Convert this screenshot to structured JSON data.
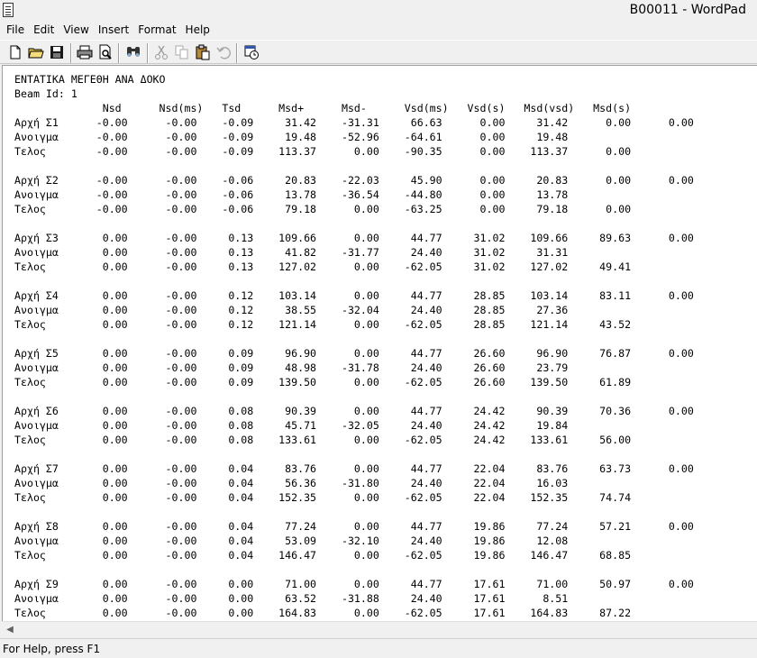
{
  "window": {
    "title": "B00011 - WordPad"
  },
  "menu": [
    "File",
    "Edit",
    "View",
    "Insert",
    "Format",
    "Help"
  ],
  "toolbar": [
    "new-icon",
    "open-icon",
    "save-icon",
    "print-icon",
    "print-preview-icon",
    "find-icon",
    "cut-icon",
    "copy-icon",
    "paste-icon",
    "undo-icon",
    "datetime-icon"
  ],
  "document": {
    "lines": [
      "ΕΝΤΑΤΙΚΑ ΜΕΓΕΘΗ ΑΝΑ ΔΟΚΟ",
      "Beam Id: 1",
      "              Nsd      Nsd(ms)   Tsd      Msd+      Msd-      Vsd(ms)   Vsd(s)   Msd(vsd)   Msd(s)",
      "Αρχή Σ1      -0.00      -0.00    -0.09     31.42    -31.31     66.63      0.00     31.42      0.00      0.00",
      "Ανοιγμα      -0.00      -0.00    -0.09     19.48    -52.96    -64.61      0.00     19.48",
      "Τελος        -0.00      -0.00    -0.09    113.37      0.00    -90.35      0.00    113.37      0.00",
      "",
      "Αρχή Σ2      -0.00      -0.00    -0.06     20.83    -22.03     45.90      0.00     20.83      0.00      0.00",
      "Ανοιγμα      -0.00      -0.00    -0.06     13.78    -36.54    -44.80      0.00     13.78",
      "Τελος        -0.00      -0.00    -0.06     79.18      0.00    -63.25      0.00     79.18      0.00",
      "",
      "Αρχή Σ3       0.00      -0.00     0.13    109.66      0.00     44.77     31.02    109.66     89.63      0.00",
      "Ανοιγμα       0.00      -0.00     0.13     41.82    -31.77     24.40     31.02     31.31",
      "Τελος         0.00      -0.00     0.13    127.02      0.00    -62.05     31.02    127.02     49.41",
      "",
      "Αρχή Σ4       0.00      -0.00     0.12    103.14      0.00     44.77     28.85    103.14     83.11      0.00",
      "Ανοιγμα       0.00      -0.00     0.12     38.55    -32.04     24.40     28.85     27.36",
      "Τελος         0.00      -0.00     0.12    121.14      0.00    -62.05     28.85    121.14     43.52",
      "",
      "Αρχή Σ5       0.00      -0.00     0.09     96.90      0.00     44.77     26.60     96.90     76.87      0.00",
      "Ανοιγμα       0.00      -0.00     0.09     48.98    -31.78     24.40     26.60     23.79",
      "Τελος         0.00      -0.00     0.09    139.50      0.00    -62.05     26.60    139.50     61.89",
      "",
      "Αρχή Σ6       0.00      -0.00     0.08     90.39      0.00     44.77     24.42     90.39     70.36      0.00",
      "Ανοιγμα       0.00      -0.00     0.08     45.71    -32.05     24.40     24.42     19.84",
      "Τελος         0.00      -0.00     0.08    133.61      0.00    -62.05     24.42    133.61     56.00",
      "",
      "Αρχή Σ7       0.00      -0.00     0.04     83.76      0.00     44.77     22.04     83.76     63.73      0.00",
      "Ανοιγμα       0.00      -0.00     0.04     56.36    -31.80     24.40     22.04     16.03",
      "Τελος         0.00      -0.00     0.04    152.35      0.00    -62.05     22.04    152.35     74.74",
      "",
      "Αρχή Σ8       0.00      -0.00     0.04     77.24      0.00     44.77     19.86     77.24     57.21      0.00",
      "Ανοιγμα       0.00      -0.00     0.04     53.09    -32.10     24.40     19.86     12.08",
      "Τελος         0.00      -0.00     0.04    146.47      0.00    -62.05     19.86    146.47     68.85",
      "",
      "Αρχή Σ9       0.00      -0.00     0.00     71.00      0.00     44.77     17.61     71.00     50.97      0.00",
      "Ανοιγμα       0.00      -0.00     0.00     63.52    -31.88     24.40     17.61      8.51",
      "Τελος         0.00      -0.00     0.00    164.83      0.00    -62.05     17.61    164.83     87.22"
    ]
  },
  "status": {
    "text": "For Help, press F1"
  }
}
